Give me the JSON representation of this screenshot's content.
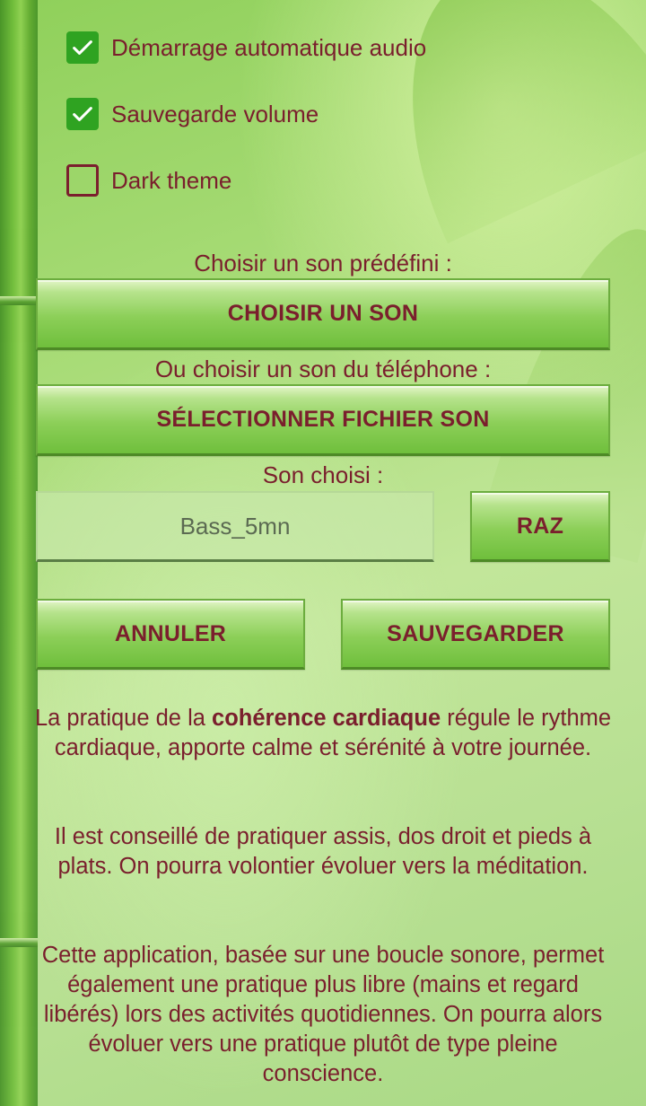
{
  "settings": {
    "checkboxes": [
      {
        "label": "Démarrage automatique audio",
        "checked": true
      },
      {
        "label": "Sauvegarde volume",
        "checked": true
      },
      {
        "label": "Dark theme",
        "checked": false
      }
    ]
  },
  "sound": {
    "predefined_caption": "Choisir un son prédéfini :",
    "choose_button": "CHOISIR UN SON",
    "phone_caption": "Ou choisir un son du téléphone :",
    "select_file_button": "SÉLECTIONNER FICHIER SON",
    "chosen_caption": "Son choisi :",
    "chosen_value": "Bass_5mn",
    "reset_button": "RAZ"
  },
  "actions": {
    "cancel": "ANNULER",
    "save": "SAUVEGARDER"
  },
  "description": {
    "p1_before": "La pratique de la ",
    "p1_bold": "cohérence cardiaque",
    "p1_after": " régule le rythme cardiaque, apporte calme et sérénité à votre journée.",
    "p2": "Il est conseillé de pratiquer assis, dos droit et pieds à plats. On pourra volontier évoluer vers la méditation.",
    "p3": "Cette application, basée sur une boucle sonore, permet également une pratique plus libre (mains et regard libérés) lors des activités quotidiennes. On pourra alors évoluer vers une pratique plutôt de type pleine conscience."
  },
  "colors": {
    "text": "#7a1f2d",
    "checkbox_checked": "#2fa321",
    "button_green": "#8ccf58"
  }
}
